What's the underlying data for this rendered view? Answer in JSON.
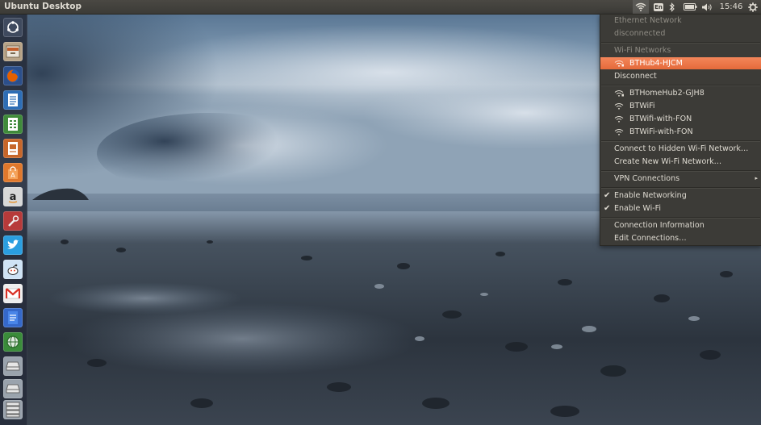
{
  "panel": {
    "app_title": "Ubuntu Desktop",
    "keyboard_layout": "En",
    "clock": "15:46"
  },
  "launcher": {
    "items": [
      {
        "name": "dash-home",
        "icon": "ubuntu-logo-icon"
      },
      {
        "name": "files",
        "icon": "file-cabinet-icon"
      },
      {
        "name": "firefox",
        "icon": "firefox-icon"
      },
      {
        "name": "libreoffice-writer",
        "icon": "writer-doc-icon"
      },
      {
        "name": "libreoffice-calc",
        "icon": "calc-sheet-icon"
      },
      {
        "name": "libreoffice-impress",
        "icon": "impress-slides-icon"
      },
      {
        "name": "software-center",
        "icon": "shopping-bag-icon"
      },
      {
        "name": "amazon",
        "icon": "amazon-icon"
      },
      {
        "name": "system-settings",
        "icon": "wrench-icon"
      },
      {
        "name": "twitter",
        "icon": "twitter-bird-icon"
      },
      {
        "name": "reddit",
        "icon": "reddit-alien-icon"
      },
      {
        "name": "gmail",
        "icon": "gmail-icon"
      },
      {
        "name": "google-docs",
        "icon": "google-docs-icon"
      },
      {
        "name": "web-browser",
        "icon": "globe-icon"
      },
      {
        "name": "drive-1",
        "icon": "drive-icon"
      },
      {
        "name": "drive-2",
        "icon": "drive-icon"
      },
      {
        "name": "drive-stack",
        "icon": "drive-stack-icon"
      }
    ]
  },
  "network_menu": {
    "ethernet_header": "Ethernet Network",
    "ethernet_status": "disconnected",
    "wifi_header": "Wi-Fi Networks",
    "connected_network": "BTHub4-HJCM",
    "disconnect": "Disconnect",
    "networks": [
      "BTHomeHub2-GJH8",
      "BTWiFi",
      "BTWifi-with-FON",
      "BTWiFi-with-FON"
    ],
    "hidden_network": "Connect to Hidden Wi-Fi Network…",
    "new_network": "Create New Wi-Fi Network…",
    "vpn": "VPN Connections",
    "enable_networking": "Enable Networking",
    "enable_wifi": "Enable Wi-Fi",
    "connection_info": "Connection Information",
    "edit_connections": "Edit Connections…",
    "check_mark": "✔",
    "submenu_arrow": "▸"
  },
  "colors": {
    "panel_bg": "#3c3b37",
    "menu_bg": "#3c3b37",
    "highlight": "#e9723f",
    "text": "#dfdbd2",
    "disabled_text": "#8f8c84"
  }
}
